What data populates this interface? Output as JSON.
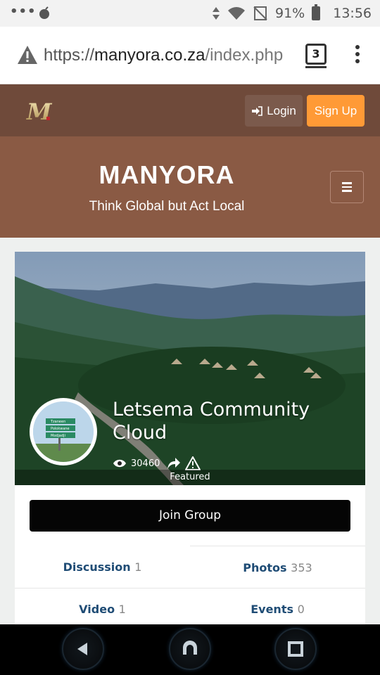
{
  "status_bar": {
    "battery": "91%",
    "time": "13:56",
    "icons": [
      "dots-icon",
      "bomb-icon",
      "data-arrows-icon",
      "wifi-icon",
      "no-signal-icon",
      "battery-icon"
    ]
  },
  "browser": {
    "url_scheme": "https://",
    "url_host": "manyora.co.za",
    "url_path": "/index.php",
    "tab_count": "3"
  },
  "site": {
    "login_label": "Login",
    "signup_label": "Sign Up",
    "title": "MANYORA",
    "tagline": "Think Global but Act Local",
    "logo_text": "M"
  },
  "group": {
    "name": "Letsema Community Cloud",
    "views": "30460",
    "featured_label": "Featured",
    "join_label": "Join Group",
    "signs": [
      "Tzaneen",
      "Polokwane",
      "Modjadji"
    ]
  },
  "tabs": [
    {
      "label": "Discussion",
      "count": "1"
    },
    {
      "label": "Photos",
      "count": "353"
    },
    {
      "label": "Video",
      "count": "1"
    },
    {
      "label": "Events",
      "count": "0"
    }
  ],
  "colors": {
    "header_dark": "#6f4a3a",
    "header_banner": "#8a5a44",
    "signup_orange": "#ff9a36",
    "tab_blue": "#1f4c75"
  }
}
